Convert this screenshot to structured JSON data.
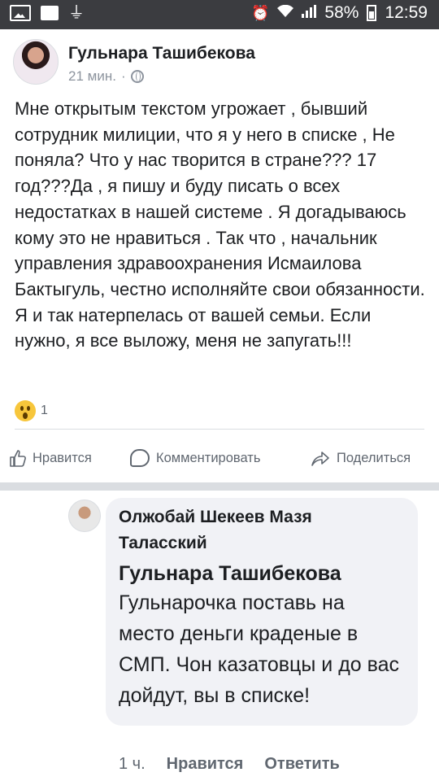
{
  "status_bar": {
    "battery": "58%",
    "time": "12:59",
    "icons": [
      "image-icon",
      "message-icon",
      "usb-icon",
      "alarm-icon",
      "wifi-icon",
      "signal-icon",
      "battery-icon"
    ]
  },
  "post": {
    "author": "Гульнара Ташибекова",
    "time": "21 мин.",
    "separator": "·",
    "privacy_icon": "globe-icon",
    "text": "Мне открытым текстом угрожает , бывший сотрудник милиции, что я у него в списке , Не поняла? Что у нас творится в стране??? 17 год???Да , я пишу и буду писать о всех недостатках в нашей системе . Я догадываюсь кому это не нравиться . Так что , начальник управления здравоохранения Исмаилова Бактыгуль, честно исполняйте свои обязанности. Я и так натерпелась от вашей семьи. Если нужно, я все выложу, меня не запугать!!!",
    "reactions": {
      "icon": "wow-icon",
      "count": "1"
    },
    "actions": {
      "like": "Нравится",
      "comment": "Комментировать",
      "share": "Поделиться"
    }
  },
  "comment": {
    "author": "Олжобай Шекеев Мазя Таласский",
    "mention": "Гульнара Ташибекова",
    "text": "Гульнарочка поставь на место деньги краденые в СМП. Чон казатовцы и до вас дойдут, вы в списке!",
    "time": "1 ч.",
    "like": "Нравится",
    "reply": "Ответить"
  },
  "colors": {
    "status_bar": "#3b3c40",
    "separator": "#dadde1",
    "bubble": "#f1f2f6",
    "meta_text": "#606770"
  }
}
